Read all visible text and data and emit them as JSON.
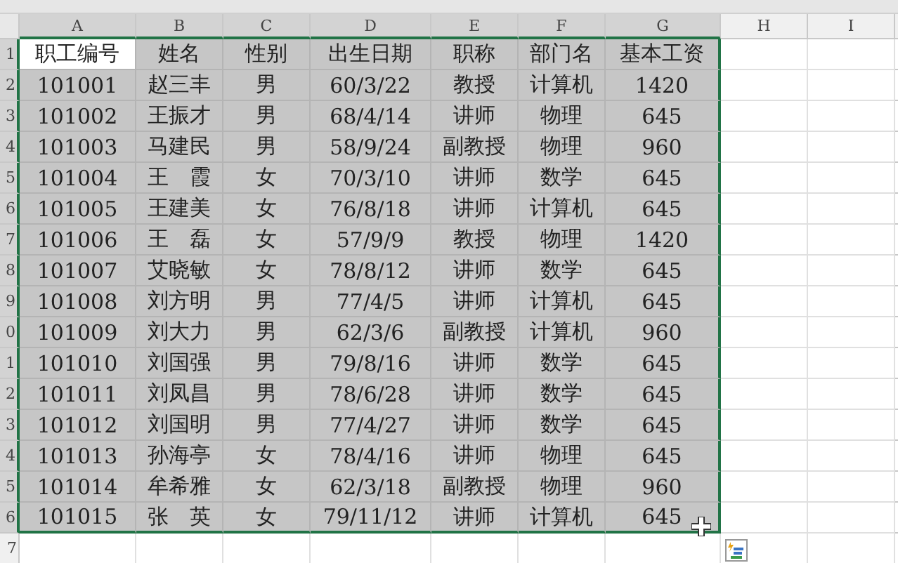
{
  "columns": [
    {
      "label": "A",
      "selected": true
    },
    {
      "label": "B",
      "selected": true
    },
    {
      "label": "C",
      "selected": true
    },
    {
      "label": "D",
      "selected": true
    },
    {
      "label": "E",
      "selected": true
    },
    {
      "label": "F",
      "selected": true
    },
    {
      "label": "G",
      "selected": true
    },
    {
      "label": "H",
      "selected": false
    },
    {
      "label": "I",
      "selected": false
    }
  ],
  "rows": [
    {
      "number": "1",
      "selected": true,
      "cells": [
        {
          "text": "职工编号",
          "active": true
        },
        {
          "text": "姓名",
          "active": false
        },
        {
          "text": "性别",
          "active": false
        },
        {
          "text": "出生日期",
          "active": false
        },
        {
          "text": "职称",
          "active": false
        },
        {
          "text": "部门名",
          "active": false
        },
        {
          "text": "基本工资",
          "active": false
        }
      ]
    },
    {
      "number": "2",
      "selected": true,
      "cells": [
        {
          "text": "101001",
          "active": false
        },
        {
          "text": "赵三丰",
          "active": false
        },
        {
          "text": "男",
          "active": false
        },
        {
          "text": "60/3/22",
          "active": false
        },
        {
          "text": "教授",
          "active": false
        },
        {
          "text": "计算机",
          "active": false
        },
        {
          "text": "1420",
          "active": false
        }
      ]
    },
    {
      "number": "3",
      "selected": true,
      "cells": [
        {
          "text": "101002",
          "active": false
        },
        {
          "text": "王振才",
          "active": false
        },
        {
          "text": "男",
          "active": false
        },
        {
          "text": "68/4/14",
          "active": false
        },
        {
          "text": "讲师",
          "active": false
        },
        {
          "text": "物理",
          "active": false
        },
        {
          "text": "645",
          "active": false
        }
      ]
    },
    {
      "number": "4",
      "selected": true,
      "cells": [
        {
          "text": "101003",
          "active": false
        },
        {
          "text": "马建民",
          "active": false
        },
        {
          "text": "男",
          "active": false
        },
        {
          "text": "58/9/24",
          "active": false
        },
        {
          "text": "副教授",
          "active": false
        },
        {
          "text": "物理",
          "active": false
        },
        {
          "text": "960",
          "active": false
        }
      ]
    },
    {
      "number": "5",
      "selected": true,
      "cells": [
        {
          "text": "101004",
          "active": false
        },
        {
          "text": "王　霞",
          "active": false
        },
        {
          "text": "女",
          "active": false
        },
        {
          "text": "70/3/10",
          "active": false
        },
        {
          "text": "讲师",
          "active": false
        },
        {
          "text": "数学",
          "active": false
        },
        {
          "text": "645",
          "active": false
        }
      ]
    },
    {
      "number": "6",
      "selected": true,
      "cells": [
        {
          "text": "101005",
          "active": false
        },
        {
          "text": "王建美",
          "active": false
        },
        {
          "text": "女",
          "active": false
        },
        {
          "text": "76/8/18",
          "active": false
        },
        {
          "text": "讲师",
          "active": false
        },
        {
          "text": "计算机",
          "active": false
        },
        {
          "text": "645",
          "active": false
        }
      ]
    },
    {
      "number": "7",
      "selected": true,
      "cells": [
        {
          "text": "101006",
          "active": false
        },
        {
          "text": "王　磊",
          "active": false
        },
        {
          "text": "女",
          "active": false
        },
        {
          "text": "57/9/9",
          "active": false
        },
        {
          "text": "教授",
          "active": false
        },
        {
          "text": "物理",
          "active": false
        },
        {
          "text": "1420",
          "active": false
        }
      ]
    },
    {
      "number": "8",
      "selected": true,
      "cells": [
        {
          "text": "101007",
          "active": false
        },
        {
          "text": "艾晓敏",
          "active": false
        },
        {
          "text": "女",
          "active": false
        },
        {
          "text": "78/8/12",
          "active": false
        },
        {
          "text": "讲师",
          "active": false
        },
        {
          "text": "数学",
          "active": false
        },
        {
          "text": "645",
          "active": false
        }
      ]
    },
    {
      "number": "9",
      "selected": true,
      "cells": [
        {
          "text": "101008",
          "active": false
        },
        {
          "text": "刘方明",
          "active": false
        },
        {
          "text": "男",
          "active": false
        },
        {
          "text": "77/4/5",
          "active": false
        },
        {
          "text": "讲师",
          "active": false
        },
        {
          "text": "计算机",
          "active": false
        },
        {
          "text": "645",
          "active": false
        }
      ]
    },
    {
      "number": "0",
      "selected": true,
      "cells": [
        {
          "text": "101009",
          "active": false
        },
        {
          "text": "刘大力",
          "active": false
        },
        {
          "text": "男",
          "active": false
        },
        {
          "text": "62/3/6",
          "active": false
        },
        {
          "text": "副教授",
          "active": false
        },
        {
          "text": "计算机",
          "active": false
        },
        {
          "text": "960",
          "active": false
        }
      ]
    },
    {
      "number": "1",
      "selected": true,
      "cells": [
        {
          "text": "101010",
          "active": false
        },
        {
          "text": "刘国强",
          "active": false
        },
        {
          "text": "男",
          "active": false
        },
        {
          "text": "79/8/16",
          "active": false
        },
        {
          "text": "讲师",
          "active": false
        },
        {
          "text": "数学",
          "active": false
        },
        {
          "text": "645",
          "active": false
        }
      ]
    },
    {
      "number": "2",
      "selected": true,
      "cells": [
        {
          "text": "101011",
          "active": false
        },
        {
          "text": "刘凤昌",
          "active": false
        },
        {
          "text": "男",
          "active": false
        },
        {
          "text": "78/6/28",
          "active": false
        },
        {
          "text": "讲师",
          "active": false
        },
        {
          "text": "数学",
          "active": false
        },
        {
          "text": "645",
          "active": false
        }
      ]
    },
    {
      "number": "3",
      "selected": true,
      "cells": [
        {
          "text": "101012",
          "active": false
        },
        {
          "text": "刘国明",
          "active": false
        },
        {
          "text": "男",
          "active": false
        },
        {
          "text": "77/4/27",
          "active": false
        },
        {
          "text": "讲师",
          "active": false
        },
        {
          "text": "数学",
          "active": false
        },
        {
          "text": "645",
          "active": false
        }
      ]
    },
    {
      "number": "4",
      "selected": true,
      "cells": [
        {
          "text": "101013",
          "active": false
        },
        {
          "text": "孙海亭",
          "active": false
        },
        {
          "text": "女",
          "active": false
        },
        {
          "text": "78/4/16",
          "active": false
        },
        {
          "text": "讲师",
          "active": false
        },
        {
          "text": "物理",
          "active": false
        },
        {
          "text": "645",
          "active": false
        }
      ]
    },
    {
      "number": "5",
      "selected": true,
      "cells": [
        {
          "text": "101014",
          "active": false
        },
        {
          "text": "牟希雅",
          "active": false
        },
        {
          "text": "女",
          "active": false
        },
        {
          "text": "62/3/18",
          "active": false
        },
        {
          "text": "副教授",
          "active": false
        },
        {
          "text": "物理",
          "active": false
        },
        {
          "text": "960",
          "active": false
        }
      ]
    },
    {
      "number": "6",
      "selected": true,
      "cells": [
        {
          "text": "101015",
          "active": false
        },
        {
          "text": "张　英",
          "active": false
        },
        {
          "text": "女",
          "active": false
        },
        {
          "text": "79/11/12",
          "active": false
        },
        {
          "text": "讲师",
          "active": false
        },
        {
          "text": "计算机",
          "active": false
        },
        {
          "text": "645",
          "active": false
        }
      ]
    },
    {
      "number": "7",
      "selected": false,
      "cells": []
    }
  ]
}
